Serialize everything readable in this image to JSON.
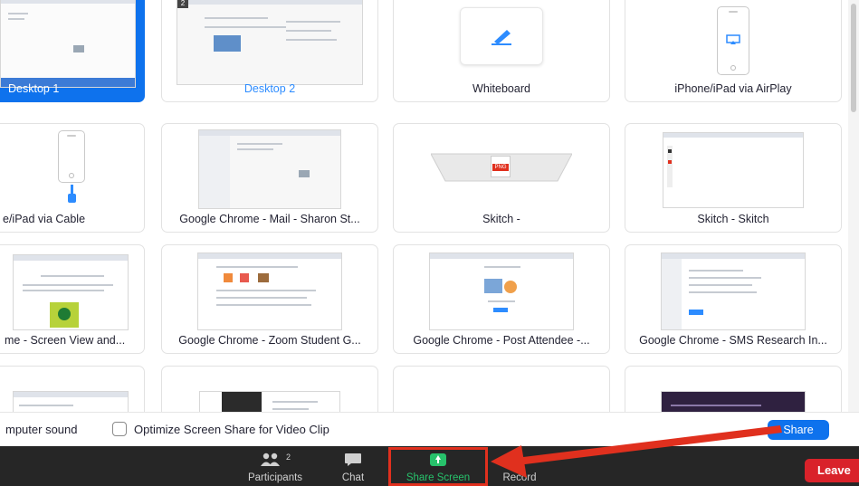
{
  "tiles": [
    {
      "label": "Desktop 1"
    },
    {
      "label": "Desktop 2",
      "badge": "2"
    },
    {
      "label": "Whiteboard"
    },
    {
      "label": "iPhone/iPad via AirPlay"
    },
    {
      "label": "e/iPad via Cable"
    },
    {
      "label": "Google Chrome - Mail - Sharon St..."
    },
    {
      "label": "Skitch -"
    },
    {
      "label": "Skitch - Skitch"
    },
    {
      "label": "me - Screen View and..."
    },
    {
      "label": "Google Chrome - Zoom Student G..."
    },
    {
      "label": "Google Chrome - Post Attendee -..."
    },
    {
      "label": "Google Chrome - SMS Research In..."
    }
  ],
  "skitch_badge": "PNG",
  "options": {
    "computer_sound": "mputer sound",
    "optimize_label": "Optimize Screen Share for Video Clip",
    "optimize_checked": false,
    "share_button": "Share"
  },
  "toolbar": {
    "participants_label": "Participants",
    "participants_count": "2",
    "chat_label": "Chat",
    "share_screen_label": "Share Screen",
    "record_label": "Record",
    "leave_label": "Leave"
  },
  "colors": {
    "accent": "#0e72ed",
    "share_green": "#27c26b",
    "annotation_red": "#e0301e",
    "leave_red": "#d9222a",
    "toolbar_bg": "#262626"
  }
}
